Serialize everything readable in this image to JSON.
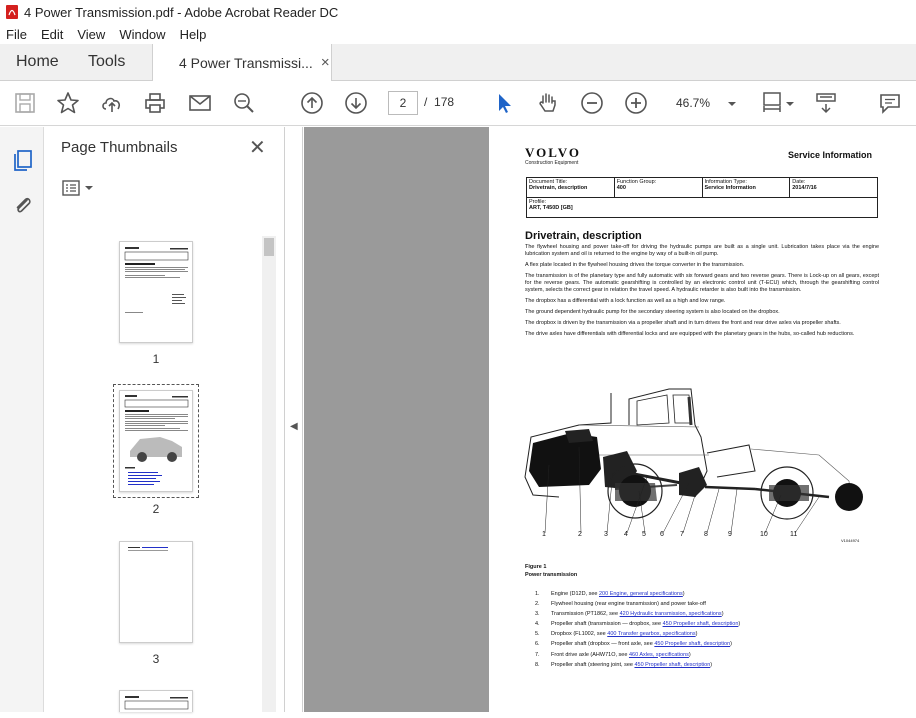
{
  "window": {
    "title": "4 Power Transmission.pdf - Adobe Acrobat Reader DC"
  },
  "menu": {
    "items": [
      "File",
      "Edit",
      "View",
      "Window",
      "Help"
    ]
  },
  "tabs": {
    "home": "Home",
    "tools": "Tools",
    "document": "4 Power Transmissi...",
    "close_symbol": "×"
  },
  "toolbar": {
    "icons": [
      "save-icon",
      "bookmark-star-icon",
      "upload-cloud-icon",
      "print-icon",
      "email-icon",
      "search-zoom-icon",
      "page-up-icon",
      "page-down-icon",
      "select-pointer-icon",
      "hand-pan-icon",
      "zoom-out-icon",
      "zoom-in-icon",
      "page-fit-icon",
      "read-mode-icon",
      "comment-icon"
    ],
    "current_page": "2",
    "page_separator": "/",
    "total_pages": "178",
    "zoom": "46.7%"
  },
  "thumbnails_panel": {
    "title": "Page Thumbnails",
    "close_symbol": "✕",
    "pages": [
      "1",
      "2",
      "3"
    ],
    "selected_page": "2"
  },
  "document_page": {
    "logo": "VOLVO",
    "logo_sub": "Construction Equipment",
    "service_info": "Service Information",
    "info_table": {
      "doc_title_label": "Document Title:",
      "doc_title": "Drivetrain, description",
      "function_group_label": "Function Group:",
      "function_group": "400",
      "info_type_label": "Information Type:",
      "info_type": "Service Information",
      "date_label": "Date:",
      "date": "2014/7/16",
      "profile_label": "Profile:",
      "profile": "ART, T450D [GB]"
    },
    "heading": "Drivetrain, description",
    "paragraphs": [
      "The flywheel housing and power take-off for driving the hydraulic pumps are built as a single unit. Lubrication takes place via the engine lubrication system and oil is returned to the engine by way of a built-in oil pump.",
      "A flex plate located in the flywheel housing drives the torque converter in the transmission.",
      "The transmission is of the planetary type and fully automatic with six forward gears and two reverse gears. There is Lock-up on all gears, except for the reverse gears. The automatic gearshifting is controlled by an electronic control unit (T-ECU) which, through the gearshifting control system, selects the correct gear in relation the travel speed. A hydraulic retarder is also built into the transmission.",
      "The dropbox has a differential with a lock function as well as a high and low range.",
      "The ground dependent hydraulic pump for the secondary steering system is also located on the dropbox.",
      "The dropbox is driven by the transmission via a propeller shaft and in turn drives the front and rear drive axles via propeller shafts.",
      "The drive axles have differentials with differential locks and are equipped with the planetary gears in the hubs, so-called hub reductions."
    ],
    "callouts": [
      "1",
      "2",
      "3",
      "4",
      "5",
      "6",
      "7",
      "8",
      "9",
      "10",
      "11"
    ],
    "figure_id": "V1044974",
    "figure_label": "Figure 1",
    "figure_caption": "Power transmission",
    "legend": [
      {
        "n": "1.",
        "text": "Engine (D12D, see ",
        "link": "200 Engine, general specifications",
        "tail": ")"
      },
      {
        "n": "2.",
        "text": "Flywheel housing (rear engine transmission) and power take-off",
        "link": "",
        "tail": ""
      },
      {
        "n": "3.",
        "text": "Transmission (PT1862, see ",
        "link": "420 Hydraulic transmission, specifications",
        "tail": ")"
      },
      {
        "n": "4.",
        "text": "Propeller shaft (transmission — dropbox, see ",
        "link": "450 Propeller shaft, description",
        "tail": ")"
      },
      {
        "n": "5.",
        "text": "Dropbox (FL1002, see ",
        "link": "400 Transfer gearbox, specifications",
        "tail": ")"
      },
      {
        "n": "6.",
        "text": "Propeller shaft (dropbox — front axle, see ",
        "link": "450 Propeller shaft, description",
        "tail": ")"
      },
      {
        "n": "7.",
        "text": "Front drive axle (AHW71O, see ",
        "link": "460 Axles, specifications",
        "tail": ")"
      },
      {
        "n": "8.",
        "text": "Propeller shaft (steering joint, see ",
        "link": "450 Propeller shaft, description",
        "tail": ")"
      }
    ]
  }
}
